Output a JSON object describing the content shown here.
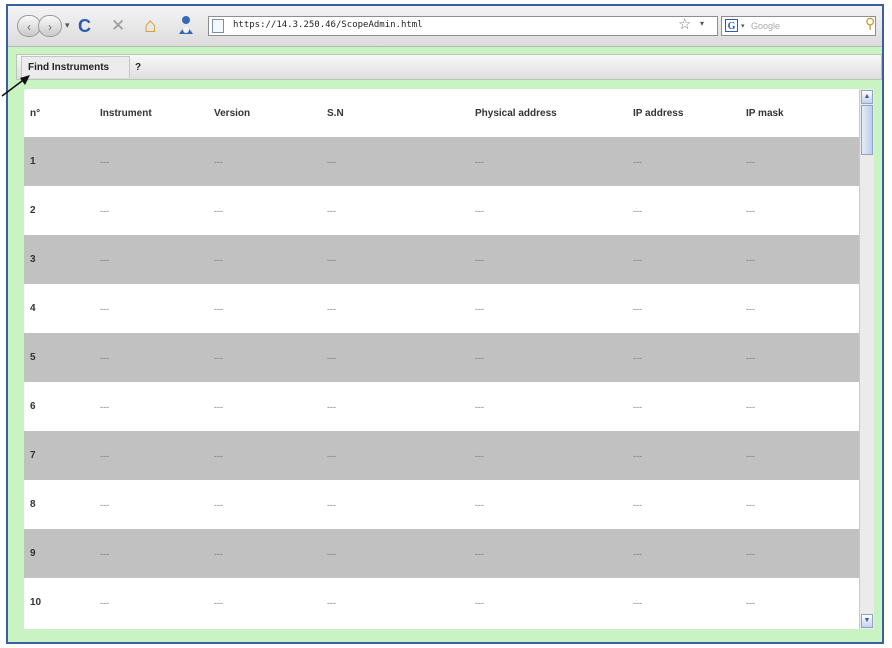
{
  "browser": {
    "back_glyph": "‹",
    "forward_glyph": "›",
    "history_drop_glyph": "▾",
    "reload_glyph": "C",
    "stop_glyph": "✕",
    "home_glyph": "⌂",
    "url": "https://14.3.250.46/ScopeAdmin.html",
    "star_glyph": "☆",
    "url_drop_glyph": "▾",
    "search_engine_letter": "G",
    "search_drop_glyph": "▾",
    "search_placeholder": "Google",
    "search_glyph": "⚲",
    "icons": [
      "back-icon",
      "forward-icon",
      "reload-icon",
      "stop-icon",
      "home-icon",
      "addon-icon",
      "page-icon",
      "bookmark-star-icon",
      "google-icon",
      "search-icon"
    ]
  },
  "app": {
    "tabs": [
      {
        "label": "Find Instruments"
      },
      {
        "label": "?"
      }
    ],
    "grid": {
      "columns": [
        "n°",
        "Instrument",
        "Version",
        "S.N",
        "Physical address",
        "IP address",
        "IP mask"
      ],
      "rows": [
        {
          "n": "1",
          "cells": [
            "---",
            "---",
            "---",
            "---",
            "---",
            "---"
          ]
        },
        {
          "n": "2",
          "cells": [
            "---",
            "---",
            "---",
            "---",
            "---",
            "---"
          ]
        },
        {
          "n": "3",
          "cells": [
            "---",
            "---",
            "---",
            "---",
            "---",
            "---"
          ]
        },
        {
          "n": "4",
          "cells": [
            "---",
            "---",
            "---",
            "---",
            "---",
            "---"
          ]
        },
        {
          "n": "5",
          "cells": [
            "---",
            "---",
            "---",
            "---",
            "---",
            "---"
          ]
        },
        {
          "n": "6",
          "cells": [
            "---",
            "---",
            "---",
            "---",
            "---",
            "---"
          ]
        },
        {
          "n": "7",
          "cells": [
            "---",
            "---",
            "---",
            "---",
            "---",
            "---"
          ]
        },
        {
          "n": "8",
          "cells": [
            "---",
            "---",
            "---",
            "---",
            "---",
            "---"
          ]
        },
        {
          "n": "9",
          "cells": [
            "---",
            "---",
            "---",
            "---",
            "---",
            "---"
          ]
        },
        {
          "n": "10",
          "cells": [
            "---",
            "---",
            "---",
            "---",
            "---",
            "---"
          ]
        }
      ],
      "scroll_up_glyph": "▲",
      "scroll_down_glyph": "▼"
    }
  },
  "colors": {
    "window_border": "#3a5fa0",
    "app_background": "#c9f3c2",
    "row_odd": "#c1c1c1",
    "row_even": "#ffffff",
    "reload": "#2a5db0",
    "home": "#d29a2a",
    "addon": "#3568b5"
  }
}
